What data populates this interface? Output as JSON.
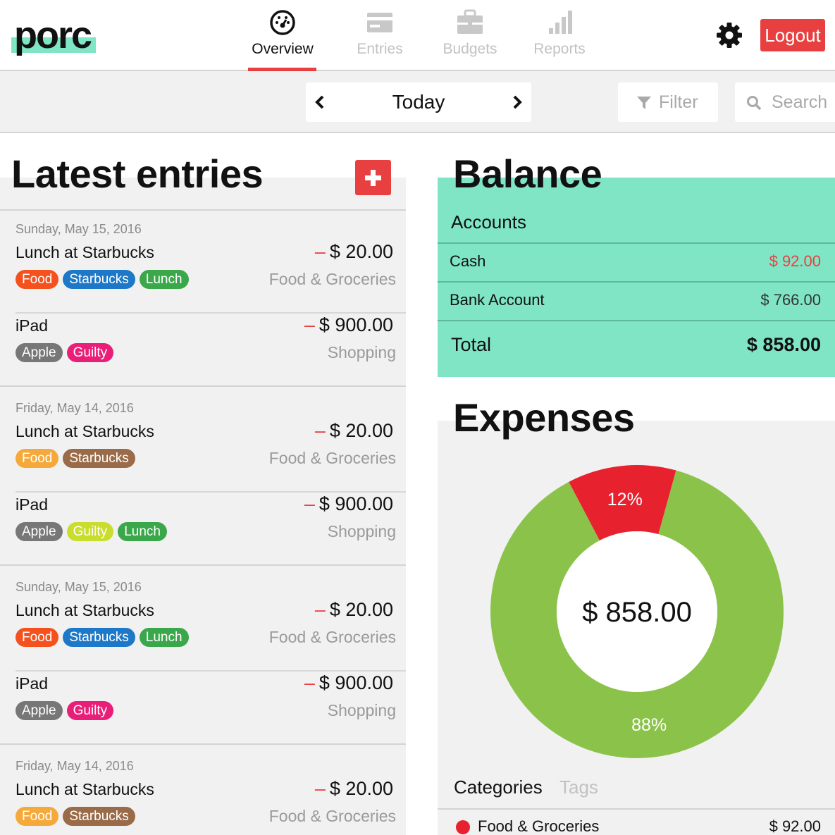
{
  "brand": {
    "logo": "porc",
    "accent": "#7fe5c5",
    "red": "#e84040",
    "green": "#8bc34a"
  },
  "nav": {
    "items": [
      {
        "label": "Overview",
        "icon": "dashboard-icon",
        "active": true
      },
      {
        "label": "Entries",
        "icon": "card-icon",
        "active": false
      },
      {
        "label": "Budgets",
        "icon": "briefcase-icon",
        "active": false
      },
      {
        "label": "Reports",
        "icon": "bar-signal-icon",
        "active": false
      }
    ],
    "settings_icon": "gear-icon",
    "logout_label": "Logout"
  },
  "toolbar": {
    "date_label": "Today",
    "prev_icon": "chevron-left-icon",
    "next_icon": "chevron-right-icon",
    "filter_label": "Filter",
    "filter_icon": "funnel-icon",
    "search_label": "Search",
    "search_icon": "search-icon"
  },
  "entries_panel": {
    "title": "Latest entries",
    "add_icon": "plus-icon",
    "groups": [
      {
        "date": "Sunday, May 15, 2016",
        "entries": [
          {
            "name": "Lunch at Starbucks",
            "amount": "$ 20.00",
            "sign": "–",
            "category": "Food & Groceries",
            "tags": [
              {
                "label": "Food",
                "color": "#f4511e"
              },
              {
                "label": "Starbucks",
                "color": "#1e78c8"
              },
              {
                "label": "Lunch",
                "color": "#3aa84a"
              }
            ]
          },
          {
            "name": "iPad",
            "amount": "$ 900.00",
            "sign": "–",
            "category": "Shopping",
            "tags": [
              {
                "label": "Apple",
                "color": "#777777"
              },
              {
                "label": "Guilty",
                "color": "#e91e78"
              }
            ]
          }
        ]
      },
      {
        "date": "Friday, May 14, 2016",
        "entries": [
          {
            "name": "Lunch at Starbucks",
            "amount": "$ 20.00",
            "sign": "–",
            "category": "Food & Groceries",
            "tags": [
              {
                "label": "Food",
                "color": "#f5a93a"
              },
              {
                "label": "Starbucks",
                "color": "#9a6b48"
              }
            ]
          },
          {
            "name": "iPad",
            "amount": "$ 900.00",
            "sign": "–",
            "category": "Shopping",
            "tags": [
              {
                "label": "Apple",
                "color": "#777777"
              },
              {
                "label": "Guilty",
                "color": "#c9dd2c"
              },
              {
                "label": "Lunch",
                "color": "#3aa84a"
              }
            ]
          }
        ]
      },
      {
        "date": "Sunday, May 15, 2016",
        "entries": [
          {
            "name": "Lunch at Starbucks",
            "amount": "$ 20.00",
            "sign": "–",
            "category": "Food & Groceries",
            "tags": [
              {
                "label": "Food",
                "color": "#f4511e"
              },
              {
                "label": "Starbucks",
                "color": "#1e78c8"
              },
              {
                "label": "Lunch",
                "color": "#3aa84a"
              }
            ]
          },
          {
            "name": "iPad",
            "amount": "$ 900.00",
            "sign": "–",
            "category": "Shopping",
            "tags": [
              {
                "label": "Apple",
                "color": "#777777"
              },
              {
                "label": "Guilty",
                "color": "#e91e78"
              }
            ]
          }
        ]
      },
      {
        "date": "Friday, May 14, 2016",
        "entries": [
          {
            "name": "Lunch at Starbucks",
            "amount": "$ 20.00",
            "sign": "–",
            "category": "Food & Groceries",
            "tags": [
              {
                "label": "Food",
                "color": "#f5a93a"
              },
              {
                "label": "Starbucks",
                "color": "#9a6b48"
              }
            ]
          }
        ]
      }
    ]
  },
  "balance": {
    "title": "Balance",
    "accounts_heading": "Accounts",
    "accounts": [
      {
        "name": "Cash",
        "value": "$ 92.00",
        "color": "#e84040"
      },
      {
        "name": "Bank Account",
        "value": "$ 766.00",
        "color": "#333333"
      }
    ],
    "total_label": "Total",
    "total_value": "$ 858.00"
  },
  "expenses": {
    "title": "Expenses",
    "center_total": "$ 858.00",
    "tabs": [
      {
        "label": "Categories",
        "active": true
      },
      {
        "label": "Tags",
        "active": false
      }
    ],
    "legend": [
      {
        "label": "Food & Groceries",
        "value": "$ 92.00",
        "color": "#e8212f"
      }
    ]
  },
  "chart_data": {
    "type": "pie",
    "title": "Expenses",
    "categories": [
      "Food & Groceries",
      "Shopping"
    ],
    "values": [
      12,
      88
    ],
    "value_labels": [
      "12%",
      "88%"
    ],
    "colors": [
      "#e8212f",
      "#8bc34a"
    ],
    "donut": true
  }
}
